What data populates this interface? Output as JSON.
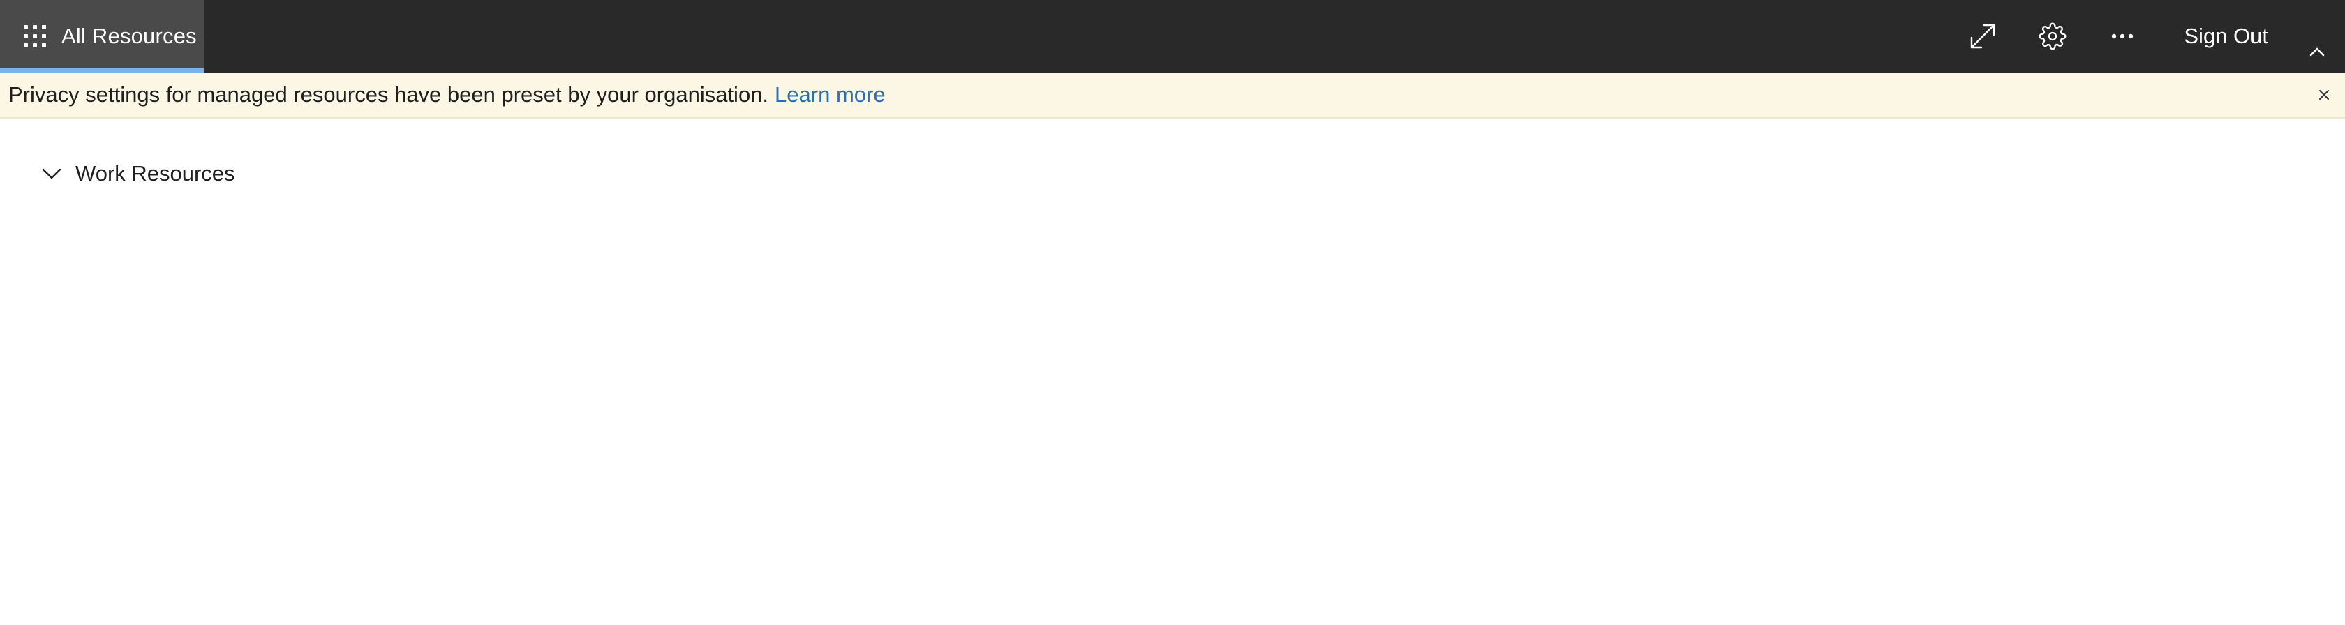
{
  "header": {
    "tab_label": "All Resources",
    "sign_out_label": "Sign Out",
    "icons": {
      "apps": "waffle-icon",
      "fullscreen": "expand-arrows-icon",
      "settings": "gear-icon",
      "more": "ellipsis-icon",
      "collapse": "chevron-up-icon"
    }
  },
  "banner": {
    "message": "Privacy settings for managed resources have been preset by your organisation.",
    "link_label": "Learn more",
    "close_icon": "close-icon"
  },
  "section": {
    "title": "Work Resources",
    "chevron_icon": "chevron-down-icon"
  },
  "colors": {
    "topbar_bg": "#292929",
    "active_tab_bg": "#4a4a4a",
    "active_tab_indicator": "#7fb2e8",
    "banner_bg": "#fbf7e4",
    "link": "#2a6fb0"
  }
}
